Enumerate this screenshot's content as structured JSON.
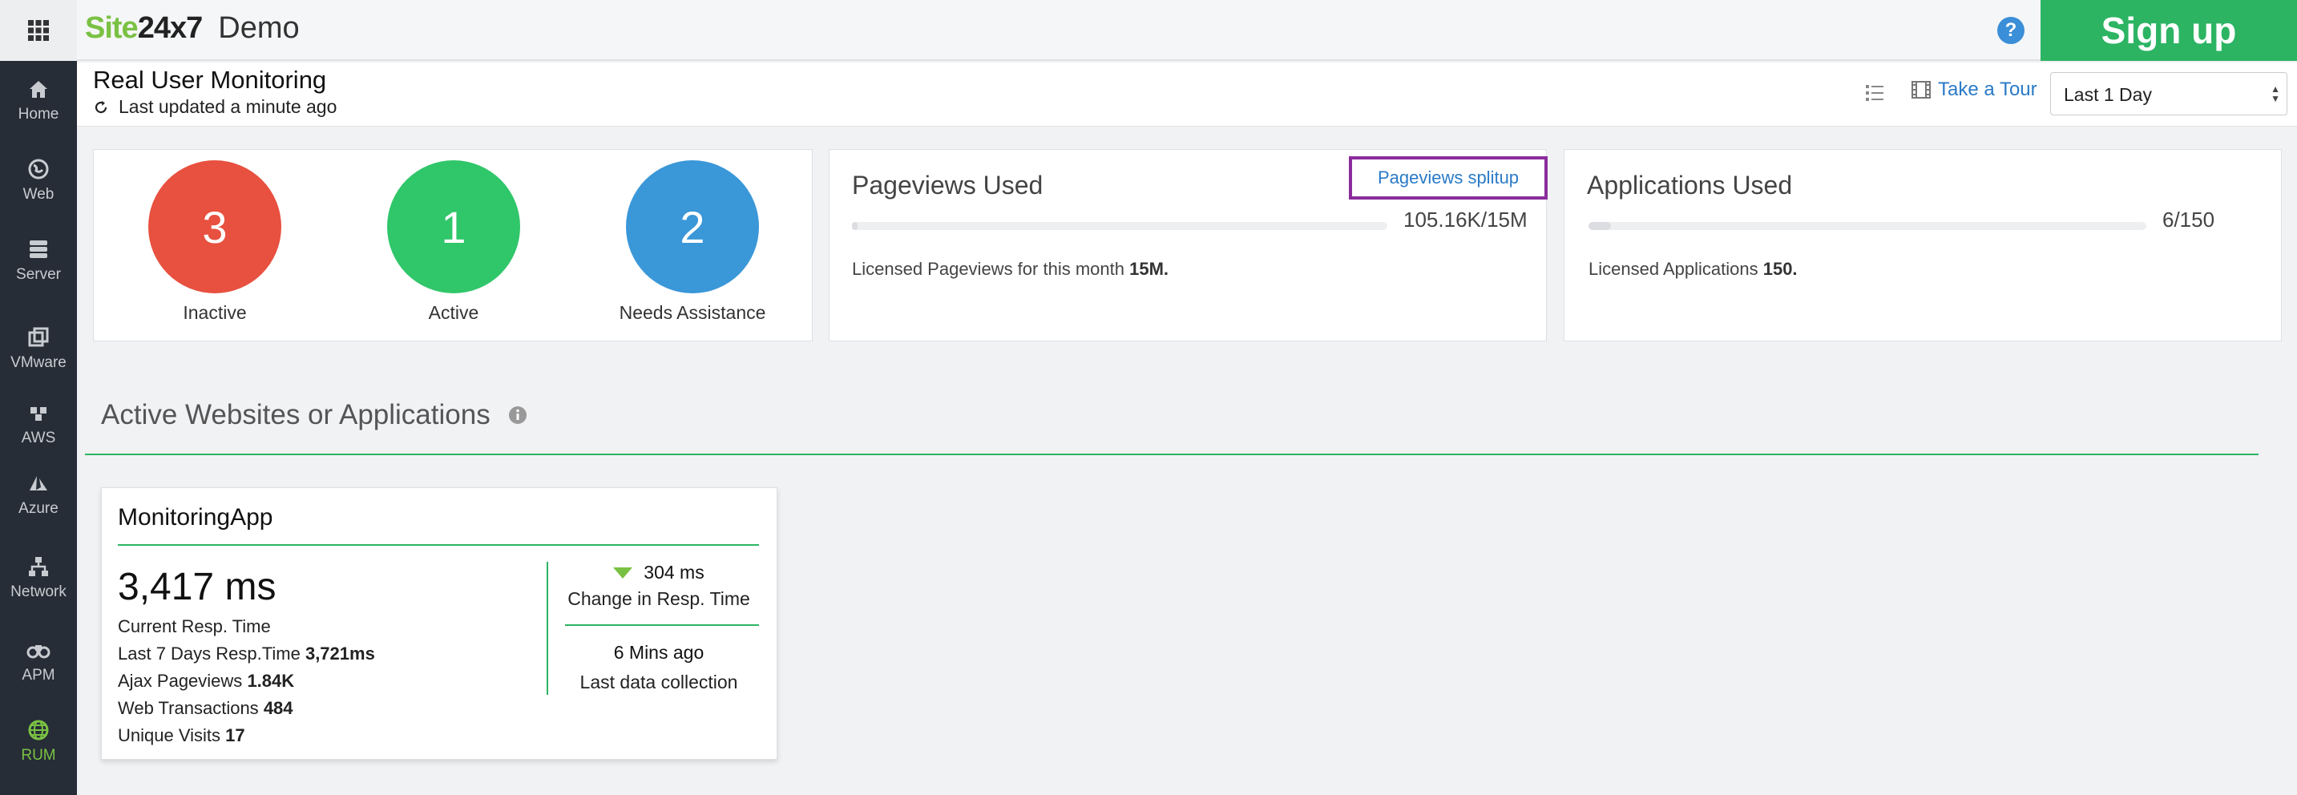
{
  "topbar": {
    "brand_site": "Site",
    "brand_num": "24x7",
    "brand_demo": "Demo",
    "help_label": "?",
    "signup_label": "Sign up"
  },
  "sidebar": {
    "items": [
      {
        "label": "Home",
        "icon": "home-icon"
      },
      {
        "label": "Web",
        "icon": "globe-icon"
      },
      {
        "label": "Server",
        "icon": "server-icon"
      },
      {
        "label": "VMware",
        "icon": "vmware-icon"
      },
      {
        "label": "AWS",
        "icon": "aws-icon"
      },
      {
        "label": "Azure",
        "icon": "azure-icon"
      },
      {
        "label": "Network",
        "icon": "network-icon"
      },
      {
        "label": "APM",
        "icon": "binoculars-icon"
      },
      {
        "label": "RUM",
        "icon": "rum-globe-icon",
        "active": true
      }
    ],
    "active_color": "#7ac143"
  },
  "header": {
    "title": "Real User Monitoring",
    "updated": "Last updated a minute ago",
    "tour_label": "Take a Tour",
    "period_value": "Last 1 Day"
  },
  "status": {
    "inactive": {
      "count": "3",
      "label": "Inactive",
      "color": "#e8503f"
    },
    "active": {
      "count": "1",
      "label": "Active",
      "color": "#30c66a"
    },
    "needs": {
      "count": "2",
      "label": "Needs Assistance",
      "color": "#3a97d8"
    }
  },
  "pageviews": {
    "title": "Pageviews Used",
    "splitup_label": "Pageviews splitup",
    "value": "105.16K/15M",
    "used_fraction": 0.007,
    "note_prefix": "Licensed Pageviews for this month",
    "note_value": "15M."
  },
  "applications": {
    "title": "Applications Used",
    "value": "6/150",
    "used_fraction": 0.04,
    "note_prefix": "Licensed Applications",
    "note_value": "150."
  },
  "section": {
    "title": "Active Websites or Applications"
  },
  "app": {
    "name": "MonitoringApp",
    "resp_time": "3,417 ms",
    "resp_label": "Current Resp. Time",
    "last7_label": "Last 7 Days Resp.Time",
    "last7_value": "3,721ms",
    "ajax_label": "Ajax Pageviews",
    "ajax_value": "1.84K",
    "web_label": "Web Transactions",
    "web_value": "484",
    "visits_label": "Unique Visits",
    "visits_value": "17",
    "change_value": "304 ms",
    "change_label": "Change in Resp. Time",
    "last_collection_value": "6 Mins ago",
    "last_collection_label": "Last data collection"
  }
}
